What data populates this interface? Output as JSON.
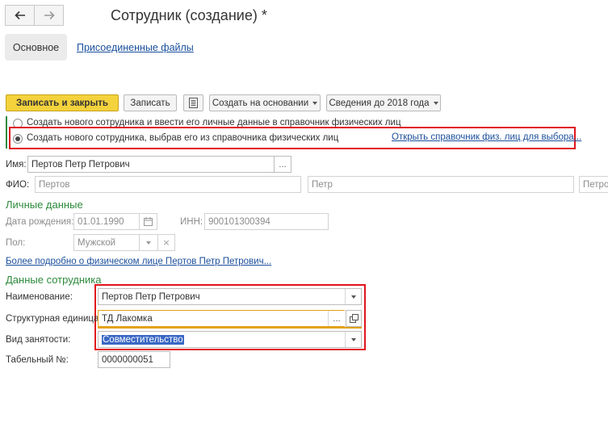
{
  "window": {
    "title": "Сотрудник (создание) *",
    "nav": {
      "back_icon": "arrow-left-icon",
      "forward_icon": "arrow-right-icon"
    }
  },
  "tabs": {
    "main": "Основное",
    "files": "Присоединенные файлы"
  },
  "toolbar": {
    "save_close": "Записать и закрыть",
    "save": "Записать",
    "report_icon": "report-icon",
    "create_based": "Создать на основании",
    "info_before_2018": "Сведения до 2018 года"
  },
  "mode": {
    "option_new": "Создать нового сотрудника и ввести его личные данные в справочник физических лиц",
    "option_select": "Создать нового сотрудника, выбрав его из справочника физических лиц",
    "open_directory_link": "Открыть справочник физ. лиц для выбора...",
    "selected": "option_select"
  },
  "person": {
    "name_label": "Имя:",
    "name_value": "Пертов Петр Петрович",
    "fio_label": "ФИО:",
    "fio_last": "Пертов",
    "fio_first": "Петр",
    "fio_middle": "Петров"
  },
  "personal": {
    "section_title": "Личные данные",
    "birth_label": "Дата рождения:",
    "birth_value": "01.01.1990",
    "inn_label": "ИНН:",
    "inn_value": "900101300394",
    "gender_label": "Пол:",
    "gender_value": "Мужской",
    "more_link": "Более подробно о физическом лице Пертов Петр Петрович..."
  },
  "employee": {
    "section_title": "Данные сотрудника",
    "name_label": "Наименование:",
    "name_value": "Пертов Петр Петрович",
    "unit_label": "Структурная единица:",
    "unit_value": "ТД Лакомка",
    "employment_label": "Вид занятости:",
    "employment_value": "Совместительство",
    "tab_label": "Табельный №:",
    "tab_value": "0000000051"
  },
  "colors": {
    "accent_yellow": "#f4d23c",
    "link_blue": "#1b4f9c",
    "section_green": "#2d8a3c",
    "highlight_red": "#e0141e",
    "selection_blue": "#3a68c4"
  }
}
